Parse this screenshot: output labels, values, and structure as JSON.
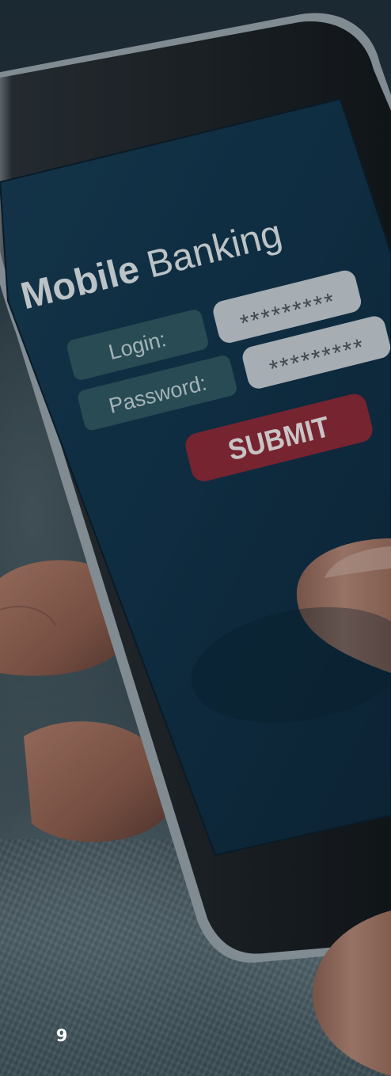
{
  "screen": {
    "title_bold": "Mobile",
    "title_light": "Banking",
    "login_label": "Login:",
    "login_value": "*********",
    "password_label": "Password:",
    "password_value": "*********",
    "submit_label": "SUBMIT"
  },
  "page_number": "9",
  "colors": {
    "screen_bg": "#123044",
    "label_pill": "#2f5660",
    "field_bg": "#c8ced3",
    "submit_bg": "#8e2634",
    "text_light": "#dfe5e9"
  }
}
